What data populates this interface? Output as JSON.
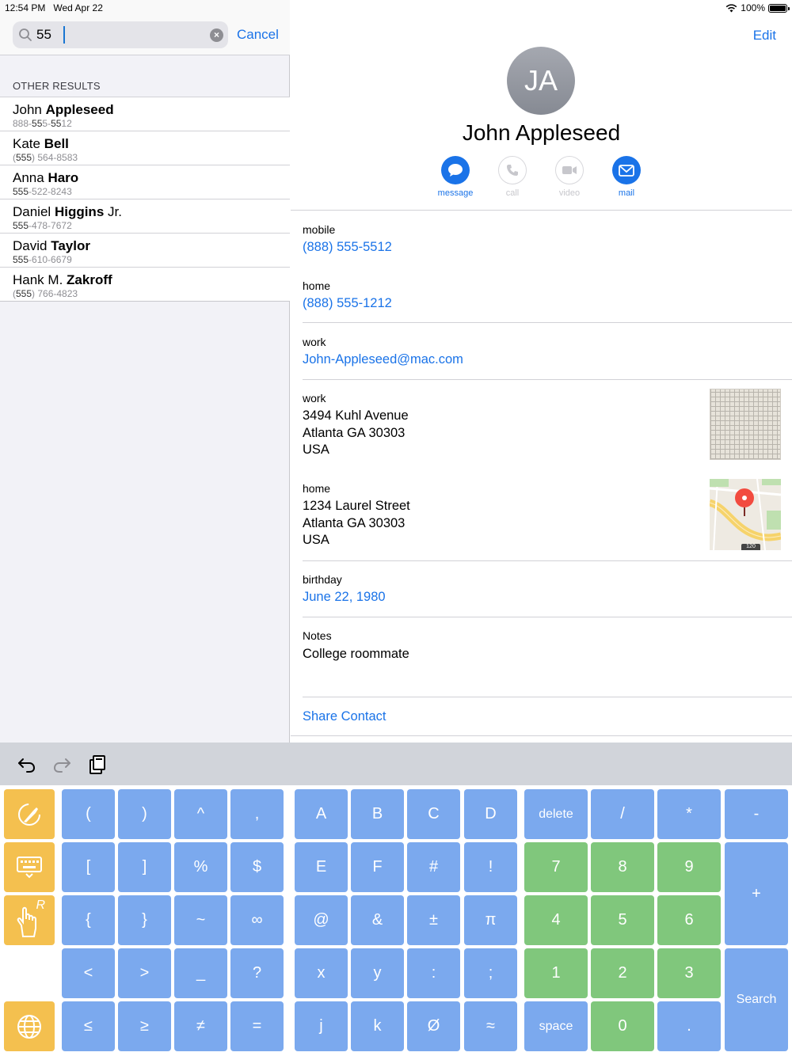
{
  "status": {
    "time": "12:54 PM",
    "date": "Wed Apr 22",
    "battery": "100%"
  },
  "search": {
    "query": "55",
    "cancel_label": "Cancel"
  },
  "results": {
    "section_title": "OTHER RESULTS",
    "items": [
      {
        "first": "John",
        "last": "Appleseed",
        "phone_pre": "888-",
        "phone_hit": "55",
        "phone_mid": "5-",
        "phone_hit2": "55",
        "phone_post": "12"
      },
      {
        "first": "Kate",
        "last": "Bell",
        "phone_pre": "(",
        "phone_hit": "555",
        "phone_mid": ") 564-8583",
        "phone_hit2": "",
        "phone_post": ""
      },
      {
        "first": "Anna",
        "last": "Haro",
        "phone_pre": "",
        "phone_hit": "555",
        "phone_mid": "-522-8243",
        "phone_hit2": "",
        "phone_post": ""
      },
      {
        "first": "Daniel",
        "last": "Higgins",
        "suffix": " Jr.",
        "phone_pre": "",
        "phone_hit": "555",
        "phone_mid": "-478-7672",
        "phone_hit2": "",
        "phone_post": ""
      },
      {
        "first": "David",
        "last": "Taylor",
        "phone_pre": "",
        "phone_hit": "555",
        "phone_mid": "-610-6679",
        "phone_hit2": "",
        "phone_post": ""
      },
      {
        "first": "Hank M.",
        "last": "Zakroff",
        "phone_pre": "(",
        "phone_hit": "555",
        "phone_mid": ") 766-4823",
        "phone_hit2": "",
        "phone_post": ""
      }
    ]
  },
  "contact": {
    "edit_label": "Edit",
    "initials": "JA",
    "name": "John Appleseed",
    "actions": {
      "message": "message",
      "call": "call",
      "video": "video",
      "mail": "mail"
    },
    "mobile_label": "mobile",
    "mobile_value": "(888) 555-5512",
    "home_label": "home",
    "home_value": "(888) 555-1212",
    "email_label": "work",
    "email_value": "John-Appleseed@mac.com",
    "work_addr_label": "work",
    "work_addr_1": "3494 Kuhl Avenue",
    "work_addr_2": "Atlanta GA 30303",
    "work_addr_3": "USA",
    "home_addr_label": "home",
    "home_addr_1": "1234 Laurel Street",
    "home_addr_2": "Atlanta GA 30303",
    "home_addr_3": "USA",
    "birthday_label": "birthday",
    "birthday_value": "June 22, 1980",
    "notes_label": "Notes",
    "notes_value": "College roommate",
    "share_label": "Share Contact",
    "map_road_sign": "120"
  },
  "keyboard": {
    "keys": {
      "paren_open": "(",
      "paren_close": ")",
      "caret": "^",
      "comma": ",",
      "A": "A",
      "B": "B",
      "C": "C",
      "D": "D",
      "delete": "delete",
      "slash": "/",
      "star": "*",
      "minus": "-",
      "bracket_open": "[",
      "bracket_close": "]",
      "percent": "%",
      "dollar": "$",
      "E": "E",
      "F": "F",
      "hash": "#",
      "bang": "!",
      "n7": "7",
      "n8": "8",
      "n9": "9",
      "plus": "+",
      "brace_open": "{",
      "brace_close": "}",
      "tilde": "~",
      "infinity": "∞",
      "at": "@",
      "amp": "&",
      "plusminus": "±",
      "pi": "π",
      "n4": "4",
      "n5": "5",
      "n6": "6",
      "lt": "<",
      "gt": ">",
      "underscore": "_",
      "question": "?",
      "x": "x",
      "y": "y",
      "colon": ":",
      "semicolon": ";",
      "n1": "1",
      "n2": "2",
      "n3": "3",
      "search": "Search",
      "le": "≤",
      "ge": "≥",
      "ne": "≠",
      "eq": "=",
      "j": "j",
      "k": "k",
      "empty": "Ø",
      "approx": "≈",
      "space": "space",
      "n0": "0",
      "dot": ".",
      "hand_r": "R"
    }
  }
}
